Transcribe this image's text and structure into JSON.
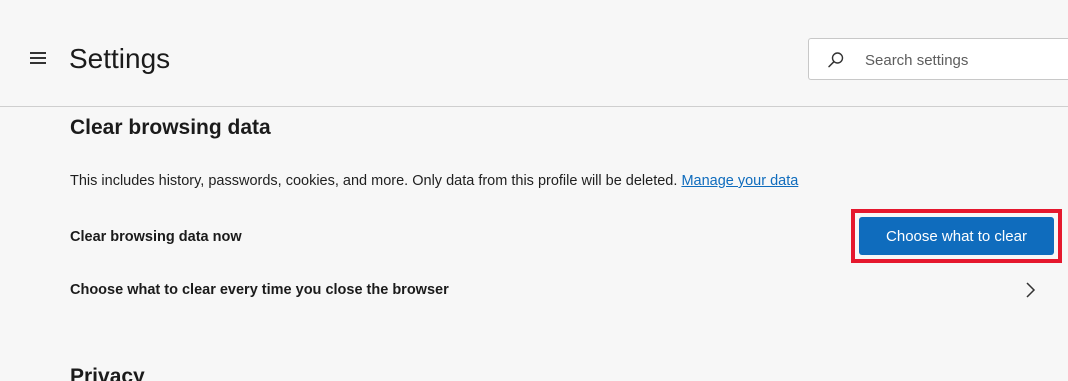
{
  "header": {
    "title": "Settings",
    "menu_icon": "hamburger-menu-icon",
    "search": {
      "placeholder": "Search settings",
      "value": "",
      "icon": "search-icon"
    }
  },
  "clear_browsing": {
    "title": "Clear browsing data",
    "description": "This includes history, passwords, cookies, and more. Only data from this profile will be deleted.",
    "manage_link": "Manage your data",
    "rows": [
      {
        "label": "Clear browsing data now",
        "button": "Choose what to clear"
      },
      {
        "label": "Choose what to clear every time you close the browser",
        "icon": "chevron-right-icon"
      }
    ]
  },
  "next_section": {
    "title": "Privacy"
  },
  "colors": {
    "accent": "#0f6cbd",
    "highlight": "#e5182e",
    "background": "#f7f7f7"
  }
}
